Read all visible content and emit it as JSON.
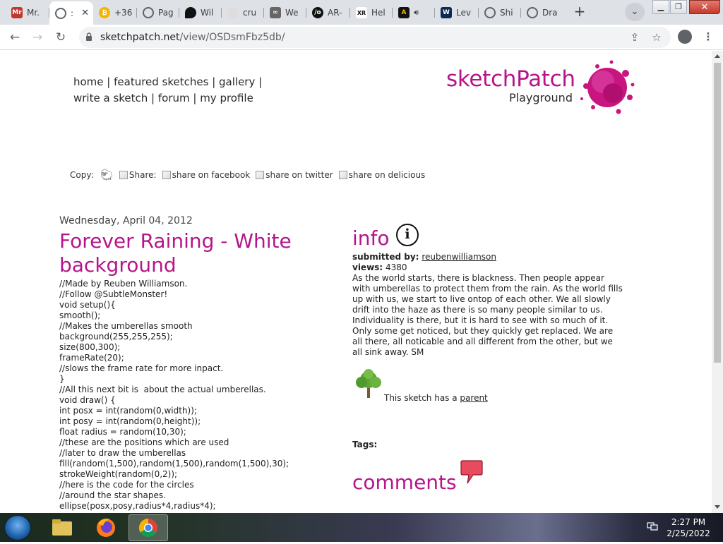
{
  "browser": {
    "tabs": [
      {
        "label": "Mr.",
        "icon": "mr-favicon",
        "color": "#c0392b"
      },
      {
        "label": ":",
        "icon": "globe-icon",
        "color": "#5f6368"
      },
      {
        "label": "+36",
        "icon": "bitcoin-favicon",
        "color": "#f5b400"
      },
      {
        "label": "Pag",
        "icon": "globe-icon",
        "color": "#5f6368"
      },
      {
        "label": "Wil",
        "icon": "drop-favicon",
        "color": "#111"
      },
      {
        "label": "cru",
        "icon": "cloud-favicon",
        "color": "#bbb"
      },
      {
        "label": "We",
        "icon": "vr-favicon",
        "color": "#444"
      },
      {
        "label": "AR-",
        "icon": "ar-favicon",
        "color": "#111"
      },
      {
        "label": "Hel",
        "icon": "xr-favicon",
        "color": "#333"
      },
      {
        "label": "",
        "icon": "a-favicon",
        "color": "#111"
      },
      {
        "label": "Lev",
        "icon": "w-favicon",
        "color": "#0b2a55"
      },
      {
        "label": "Shi",
        "icon": "globe-icon",
        "color": "#5f6368"
      },
      {
        "label": "Dra",
        "icon": "globe-icon",
        "color": "#5f6368"
      }
    ],
    "url_host": "sketchpatch.net",
    "url_path": "/view/OSDsmFbz5db/"
  },
  "site": {
    "nav_line1": "home | featured sketches | gallery |",
    "nav_line2": "write a sketch | forum | my profile",
    "brand": "sketchPatch",
    "brand_sub": "Playground",
    "copy_label": "Copy:",
    "share_label": "Share:",
    "share_facebook": "share on facebook",
    "share_twitter": "share on twitter",
    "share_delicious": "share on delicious"
  },
  "sketch": {
    "date": "Wednesday, April 04, 2012",
    "title": "Forever Raining - White background",
    "code": "//Made by Reuben Williamson.\n//Follow @SubtleMonster!\nvoid setup(){\nsmooth();\n//Makes the umberellas smooth\nbackground(255,255,255);\nsize(800,300);\nframeRate(20);\n//slows the frame rate for more inpact.\n}\n//All this next bit is  about the actual umberellas.\nvoid draw() {\nint posx = int(random(0,width));\nint posy = int(random(0,height));\nfloat radius = random(10,30);\n//these are the positions which are used\n//later to draw the umberellas\nfill(random(1,500),random(1,500),random(1,500),30);\nstrokeWeight(random(0,2));\n//here is the code for the circles\n//around the star shapes.\nellipse(posx,posy,radius*4,radius*4);"
  },
  "info": {
    "heading": "info",
    "submitted_label": "submitted by:",
    "submitted_by": "reubenwilliamson",
    "views_label": "views:",
    "views": "4380",
    "description": "As the world starts, there is blackness. Then people appear with umberellas to protect them from the rain. As the world fills up with us, we start to live ontop of each other. We all slowly drift into the haze as there is so many people similar to us. Individuality is there, but it is hard to see with so much of it. Only some get noticed, but they quickly get replaced. We are all there, all noticable and all different from the other, but we all sink away. SM",
    "parent_text": "This sketch has a",
    "parent_link": "parent",
    "tags_label": "Tags:",
    "comments_heading": "comments"
  },
  "taskbar": {
    "time": "2:27 PM",
    "date": "2/25/2022"
  },
  "colors": {
    "brand_magenta": "#b5158a"
  }
}
